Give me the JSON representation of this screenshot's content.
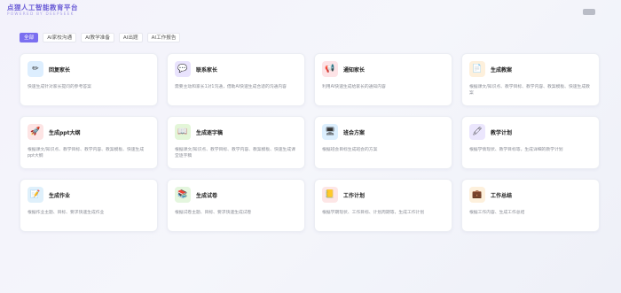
{
  "brand": {
    "title": "点狸人工智能教育平台",
    "subtitle": "POWERED BY DEEPSEEK"
  },
  "tabs": [
    {
      "label": "全部",
      "active": true
    },
    {
      "label": "AI家校沟通",
      "active": false
    },
    {
      "label": "AI教学准备",
      "active": false
    },
    {
      "label": "AI出题",
      "active": false
    },
    {
      "label": "AI工作报告",
      "active": false
    }
  ],
  "cards": [
    {
      "title": "回复家长",
      "desc": "快速生成针对家长提问的参考答案",
      "icon": "pencil-icon",
      "glyph": "✏",
      "bg": "#ddeefe"
    },
    {
      "title": "联系家长",
      "desc": "需要主动和家长1对1沟通，借助AI快速生成合适的沟通内容",
      "icon": "chat-icon",
      "glyph": "💬",
      "bg": "#e9e3fd"
    },
    {
      "title": "通知家长",
      "desc": "利用AI快速生成给家长的通知内容",
      "icon": "notice-icon",
      "glyph": "📢",
      "bg": "#fde3e6"
    },
    {
      "title": "生成教案",
      "desc": "根据课文/知识点、教学目标、教学内容、教案模板、快速生成教案",
      "icon": "document-icon",
      "glyph": "📄",
      "bg": "#fdf0dc"
    },
    {
      "title": "生成ppt大纲",
      "desc": "根据课文/知识点、教学目标、教学内容、教案模板、快速生成ppt大纲",
      "icon": "rocket-icon",
      "glyph": "🚀",
      "bg": "#fde4e4"
    },
    {
      "title": "生成逐字稿",
      "desc": "根据课文/知识点、教学目标、教学内容、教案模板、快速生成课堂逐字稿",
      "icon": "book-icon",
      "glyph": "📖",
      "bg": "#e3f6d8"
    },
    {
      "title": "班会方案",
      "desc": "根据班会目标生成班会的方案",
      "icon": "board-icon",
      "glyph": "🖥",
      "bg": "#dceffe"
    },
    {
      "title": "教学计划",
      "desc": "根据学情现状、教学目标等，生成详细的教学计划",
      "icon": "crayon-icon",
      "glyph": "🖍",
      "bg": "#ebe6fd"
    },
    {
      "title": "生成作业",
      "desc": "根据作业主题、目标、要求快速生成作业",
      "icon": "homework-icon",
      "glyph": "📝",
      "bg": "#dff0fb"
    },
    {
      "title": "生成试卷",
      "desc": "根据试卷主题、目标、要求快速生成试卷",
      "icon": "books-icon",
      "glyph": "📚",
      "bg": "#e4f6de"
    },
    {
      "title": "工作计划",
      "desc": "根据学期现状、工作目标、计划周期等，生成工作计划",
      "icon": "notebook-icon",
      "glyph": "📒",
      "bg": "#fde6e6"
    },
    {
      "title": "工作总结",
      "desc": "根据工作内容、生成工作总结",
      "icon": "briefcase-icon",
      "glyph": "💼",
      "bg": "#fdf0dc"
    }
  ]
}
